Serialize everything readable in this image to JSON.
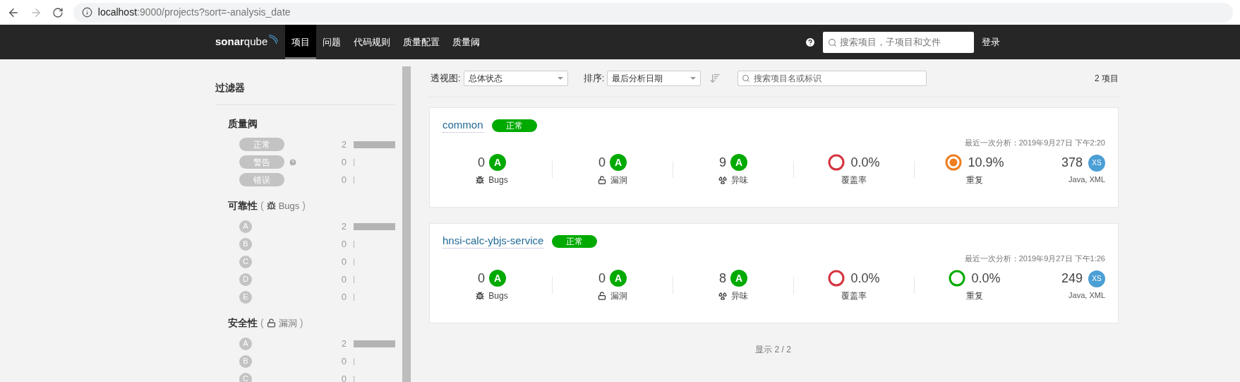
{
  "browser": {
    "url_host": "localhost",
    "url_rest": ":9000/projects?sort=-analysis_date"
  },
  "navbar": {
    "logo": "**sonar**qube",
    "tabs": [
      {
        "label": "项目",
        "selected": true
      },
      {
        "label": "问题",
        "selected": false
      },
      {
        "label": "代码规则",
        "selected": false
      },
      {
        "label": "质量配置",
        "selected": false
      },
      {
        "label": "质量阈",
        "selected": false
      }
    ],
    "search": {
      "placeholder": "搜索项目，子项目和文件"
    },
    "login": "登录"
  },
  "sidebar": {
    "title": "过滤器",
    "sections": [
      {
        "title": "质量阀",
        "kind": "gate",
        "items": [
          {
            "label": "正常",
            "count": "2",
            "help": false
          },
          {
            "label": "警告",
            "count": "0",
            "help": true
          },
          {
            "label": "错误",
            "count": "0",
            "help": false
          }
        ]
      },
      {
        "title": "可靠性",
        "kind": "rating",
        "paren_open": "(",
        "metric": "Bugs",
        "paren_close": ")",
        "items": [
          {
            "label": "A",
            "count": "2"
          },
          {
            "label": "B",
            "count": "0"
          },
          {
            "label": "C",
            "count": "0"
          },
          {
            "label": "D",
            "count": "0"
          },
          {
            "label": "E",
            "count": "0"
          }
        ]
      },
      {
        "title": "安全性",
        "kind": "rating",
        "paren_open": "(",
        "metric": "漏洞",
        "paren_close": ")",
        "items": [
          {
            "label": "A",
            "count": "2"
          },
          {
            "label": "B",
            "count": "0"
          },
          {
            "label": "C",
            "count": "0"
          }
        ]
      }
    ]
  },
  "toolbar": {
    "view_label": "透视图:",
    "view_value": "总体状态",
    "sort_label": "排序:",
    "sort_value": "最后分析日期",
    "search": {
      "placeholder": "搜索项目名或标识"
    },
    "total": "2 项目"
  },
  "projects": [
    {
      "name": "common",
      "status": "正常",
      "analysis": "最近一次分析：2019年9月27日 下午2:20",
      "measures": [
        {
          "kind": "rating",
          "value": "0",
          "rating": "A",
          "label": "Bugs"
        },
        {
          "kind": "rating",
          "value": "0",
          "rating": "A",
          "label": "漏洞"
        },
        {
          "kind": "rating",
          "value": "9",
          "rating": "A",
          "label": "异味"
        },
        {
          "kind": "ring",
          "value": "0.0%",
          "label": "覆盖率",
          "color": "#d4333f",
          "dot": false
        },
        {
          "kind": "ring",
          "value": "10.9%",
          "label": "重复",
          "color": "#ed7d20",
          "dot": true
        }
      ],
      "size": "378",
      "size_rating": "XS",
      "languages": "Java, XML"
    },
    {
      "name": "hnsi-calc-ybjs-service",
      "status": "正常",
      "analysis": "最近一次分析：2019年9月27日 下午1:26",
      "measures": [
        {
          "kind": "rating",
          "value": "0",
          "rating": "A",
          "label": "Bugs"
        },
        {
          "kind": "rating",
          "value": "0",
          "rating": "A",
          "label": "漏洞"
        },
        {
          "kind": "rating",
          "value": "8",
          "rating": "A",
          "label": "异味"
        },
        {
          "kind": "ring",
          "value": "0.0%",
          "label": "覆盖率",
          "color": "#d4333f",
          "dot": false
        },
        {
          "kind": "ring",
          "value": "0.0%",
          "label": "重复",
          "color": "#00aa00",
          "dot": false
        }
      ],
      "size": "249",
      "size_rating": "XS",
      "languages": "Java, XML"
    }
  ],
  "footer": "显示 2 / 2"
}
